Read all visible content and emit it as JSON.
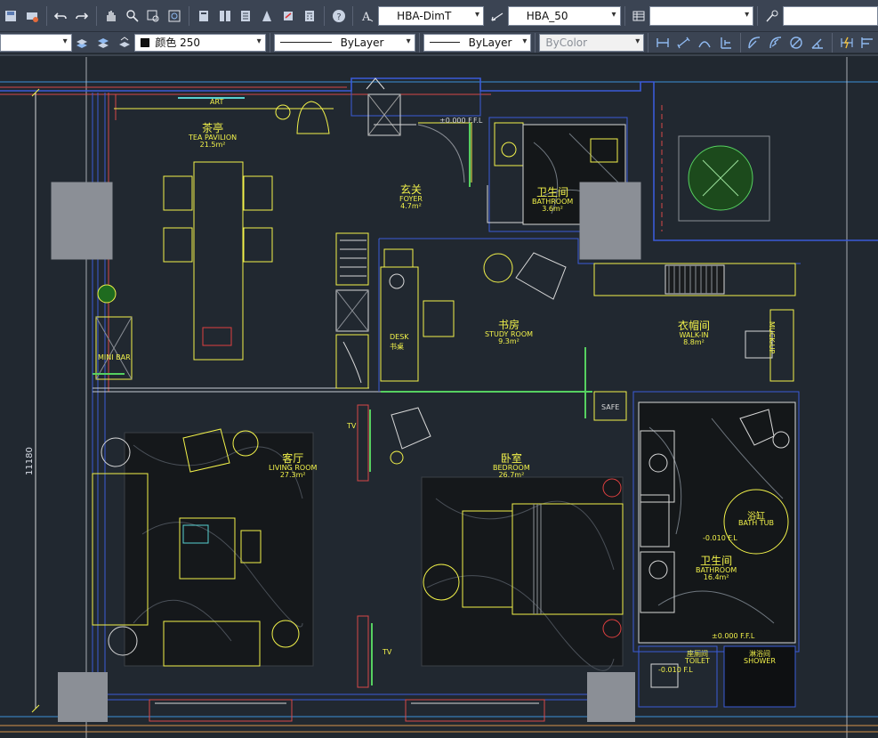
{
  "toolbar_top": {
    "dimstyle_value": "HBA-DimT",
    "tablestyle_value": "HBA_50",
    "multileader_value": "",
    "extra_value": ""
  },
  "toolbar_props": {
    "layer_value": "",
    "color_value": "颜色 250",
    "linetype_value": "ByLayer",
    "lineweight_value": "ByLayer",
    "plotstyle_value": "ByColor"
  },
  "drawing": {
    "dimension_text": "11180",
    "rooms": [
      {
        "id": "tea",
        "cn": "茶亭",
        "en": "TEA PAVILION",
        "area": "21.5m²"
      },
      {
        "id": "foyer",
        "cn": "玄关",
        "en": "FOYER",
        "area": "4.7m²"
      },
      {
        "id": "bath1",
        "cn": "卫生间",
        "en": "BATHROOM",
        "area": "3.6m²"
      },
      {
        "id": "study",
        "cn": "书房",
        "en": "STUDY ROOM",
        "area": "9.3m²"
      },
      {
        "id": "walkin",
        "cn": "衣帽间",
        "en": "WALK-IN",
        "area": "8.8m²"
      },
      {
        "id": "living",
        "cn": "客厅",
        "en": "LIVING ROOM",
        "area": "27.3m²"
      },
      {
        "id": "bedroom",
        "cn": "卧室",
        "en": "BEDROOM",
        "area": "26.7m²"
      },
      {
        "id": "bath2",
        "cn": "卫生间",
        "en": "BATHROOM",
        "area": "16.4m²"
      },
      {
        "id": "toilet",
        "cn": "座厕间",
        "en": "TOILET",
        "area": ""
      },
      {
        "id": "shower",
        "cn": "淋浴间",
        "en": "SHOWER",
        "area": ""
      }
    ],
    "labels": {
      "art": "ART",
      "mini_bar": "MINI BAR",
      "desk_en": "DESK",
      "desk_cn": "书桌",
      "tv_top": "TV",
      "tv_bottom": "TV",
      "safe": "SAFE",
      "muck_up": "MUCK-UP",
      "bath_tub_cn": "浴缸",
      "bath_tub_en": "BATH TUB",
      "level_ffl": "±0.000 F.F.L",
      "level_1": "-0.010 F.L",
      "level_2": "±0.000 F.F.L",
      "level_3": "-0.010 F.L"
    }
  }
}
